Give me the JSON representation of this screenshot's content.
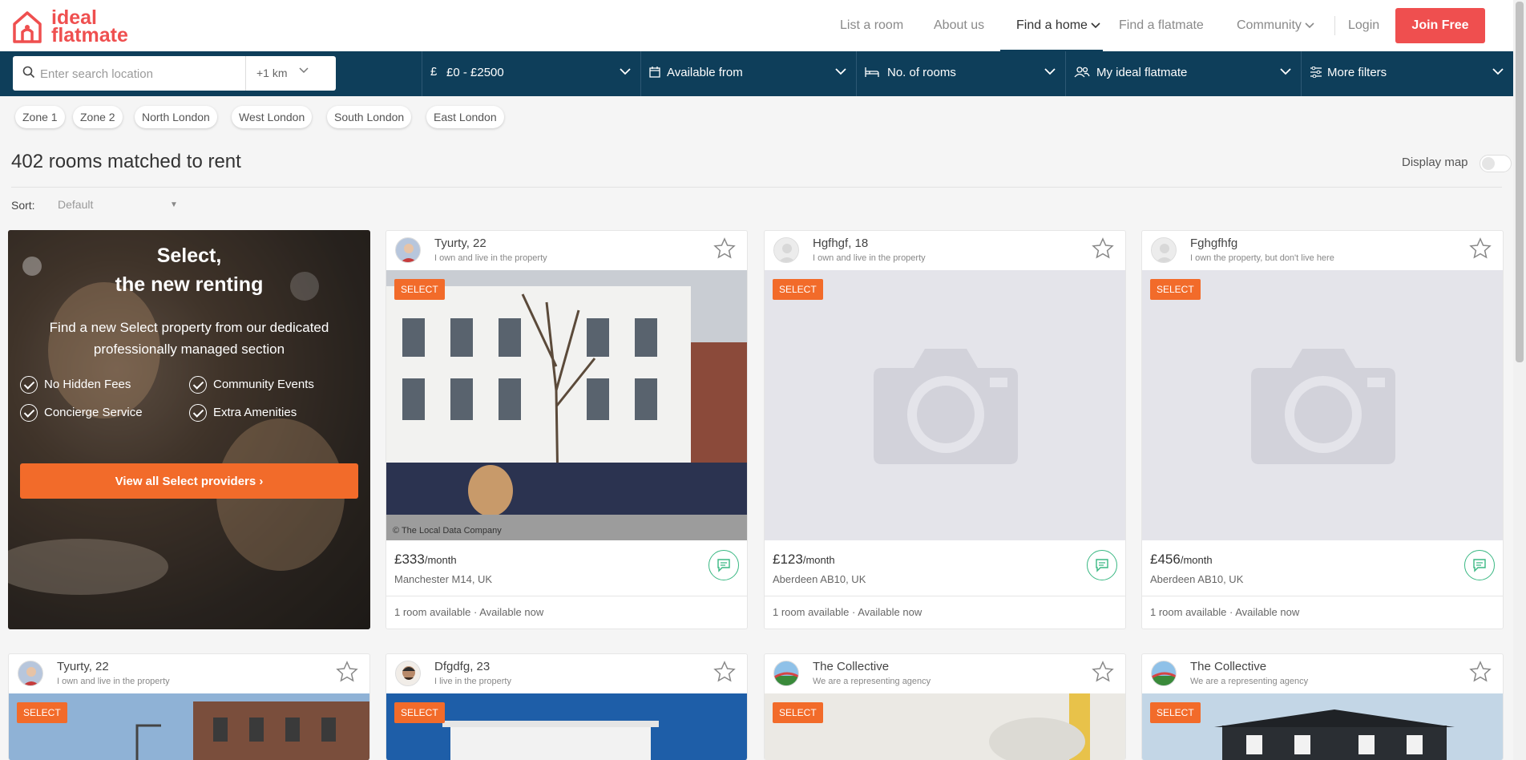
{
  "header": {
    "logo_text_line1": "ideal",
    "logo_text_line2": "flatmate",
    "nav": [
      "List a room",
      "About us",
      "Find a home",
      "Find a flatmate",
      "Community",
      "Login"
    ],
    "join_label": "Join Free"
  },
  "search": {
    "placeholder": "Enter search location",
    "radius": "+1 km",
    "price": "£0 - £2500",
    "price_symbol": "£",
    "available": "Available from",
    "rooms": "No. of rooms",
    "flatmate": "My ideal flatmate",
    "more": "More filters"
  },
  "chips": [
    "Zone 1",
    "Zone 2",
    "North London",
    "West London",
    "South London",
    "East London"
  ],
  "results": {
    "title": "402 rooms matched to rent",
    "display_map": "Display map",
    "sort_label": "Sort:",
    "sort_value": "Default"
  },
  "promo": {
    "title_line1": "Select,",
    "title_line2": "the new renting",
    "subtitle": "Find a new Select property from our dedicated professionally managed section",
    "features": [
      "No Hidden Fees",
      "Community Events",
      "Concierge Service",
      "Extra Amenities"
    ],
    "button": "View all Select providers ›"
  },
  "listings": [
    {
      "name": "Tyurty, 22",
      "role": "I own and live in the property",
      "badge": "SELECT",
      "price": "£333",
      "period": "/month",
      "location": "Manchester M14, UK",
      "availability": "1 room available · Available now",
      "photo": "street",
      "watermark": "© The Local Data Company"
    },
    {
      "name": "Hgfhgf, 18",
      "role": "I own and live in the property",
      "badge": "SELECT",
      "price": "£123",
      "period": "/month",
      "location": "Aberdeen AB10, UK",
      "availability": "1 room available · Available now",
      "photo": "placeholder"
    },
    {
      "name": "Fghgfhfg",
      "role": "I own the property, but don't live here",
      "badge": "SELECT",
      "price": "£456",
      "period": "/month",
      "location": "Aberdeen AB10, UK",
      "availability": "1 room available · Available now",
      "photo": "placeholder"
    },
    {
      "name": "Tyurty, 22",
      "role": "I own and live in the property",
      "badge": "SELECT",
      "photo": "terrace"
    },
    {
      "name": "Dfgdfg, 23",
      "role": "I live in the property",
      "badge": "SELECT",
      "photo": "sky"
    },
    {
      "name": "The Collective",
      "role": "We are a representing agency",
      "badge": "SELECT",
      "photo": "fog"
    },
    {
      "name": "The Collective",
      "role": "We are a representing agency",
      "badge": "SELECT",
      "photo": "house"
    }
  ],
  "colors": {
    "brand": "#ef4f4f",
    "navy": "#0e3e5a",
    "orange": "#f26b2a",
    "green": "#3ab883"
  }
}
